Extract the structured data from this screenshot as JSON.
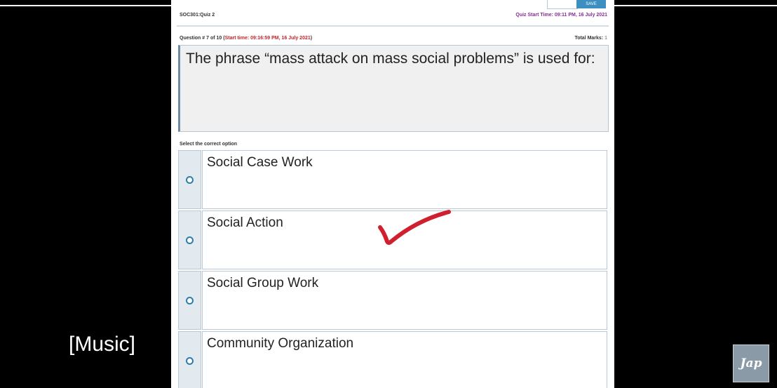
{
  "header": {
    "top_button_label": "SAVE",
    "course_quiz": "SOC301:Quiz 2",
    "quiz_start_time": "Quiz Start Time: 09:11 PM, 16 July 2021"
  },
  "question": {
    "number_prefix": "Question # 7 of 10 (",
    "start_time": "Start time: 09:16:59 PM, 16 July 2021",
    "number_suffix": ")",
    "total_marks_label": "Total Marks: ",
    "total_marks_value": "1",
    "text": "The phrase “mass attack on mass social problems” is used for:"
  },
  "select_label": "Select the correct option",
  "options": [
    {
      "label": "Social Case Work"
    },
    {
      "label": "Social Action"
    },
    {
      "label": "Social Group Work"
    },
    {
      "label": "Community Organization"
    }
  ],
  "annotation": {
    "checkmark_color": "#d01f2e",
    "marked_option": "Social Action"
  },
  "video_overlay": {
    "caption": "[Music]",
    "logo_text": "Jap"
  },
  "colors": {
    "accent": "#3e8fc1",
    "start_time": "#c2242b",
    "quiz_time": "#8a2c9b"
  }
}
